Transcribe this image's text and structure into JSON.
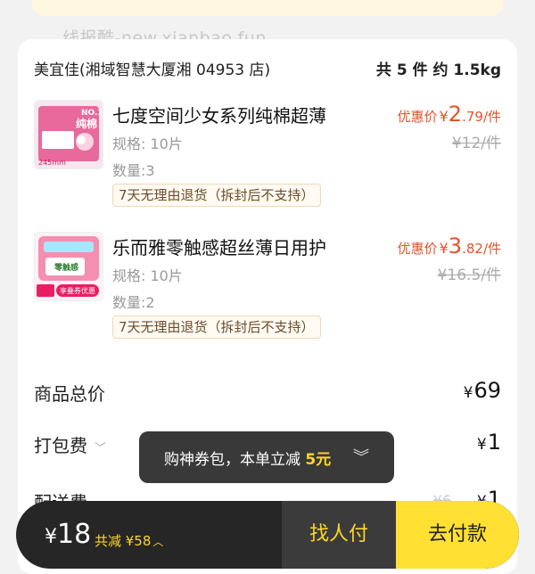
{
  "watermark": "线报酷-new.xianbao.fun",
  "store": {
    "name": "美宜佳(湘域智慧大厦湘 04953 店)",
    "summary": "共 5 件 约 1.5kg"
  },
  "items": [
    {
      "title": "七度空间少女系列纯棉超薄",
      "spec": "规格: 10片",
      "qty": "数量:3",
      "tag": "7天无理由退货（拆封后不支持）",
      "price_label": "优惠价",
      "price_yen": "¥",
      "price_int": "2",
      "price_dec": ".79",
      "price_unit": "/件",
      "orig_price": "¥12/件",
      "thumb_text": "NO.1",
      "thumb_sub": "纯棉",
      "thumb_size": "245mm"
    },
    {
      "title": "乐而雅零触感超丝薄日用护",
      "spec": "规格: 10片",
      "qty": "数量:2",
      "tag": "7天无理由退货（拆封后不支持）",
      "price_label": "优惠价",
      "price_yen": "¥",
      "price_int": "3",
      "price_dec": ".82",
      "price_unit": "/件",
      "orig_price": "¥16.5/件",
      "thumb_text": "零触感",
      "thumb_sub": "享叠券优惠"
    }
  ],
  "summary": {
    "goods_total_label": "商品总价",
    "goods_total_yen": "¥",
    "goods_total_value": "69",
    "packing_label": "打包费",
    "packing_yen": "¥",
    "packing_value": "1",
    "delivery_label": "配送费",
    "delivery_yen": "¥",
    "delivery_value": "1",
    "delivery_orig": "¥6"
  },
  "toast": {
    "text": "购神券包，本单立减",
    "amount": "5元"
  },
  "bottom_bar": {
    "yen": "¥",
    "total": "18",
    "discount": "共减 ¥58",
    "find_payer": "找人付",
    "pay": "去付款"
  },
  "colors": {
    "accent_red": "#e4532a",
    "accent_yellow": "#ffe033",
    "bar_dark": "#262626"
  }
}
